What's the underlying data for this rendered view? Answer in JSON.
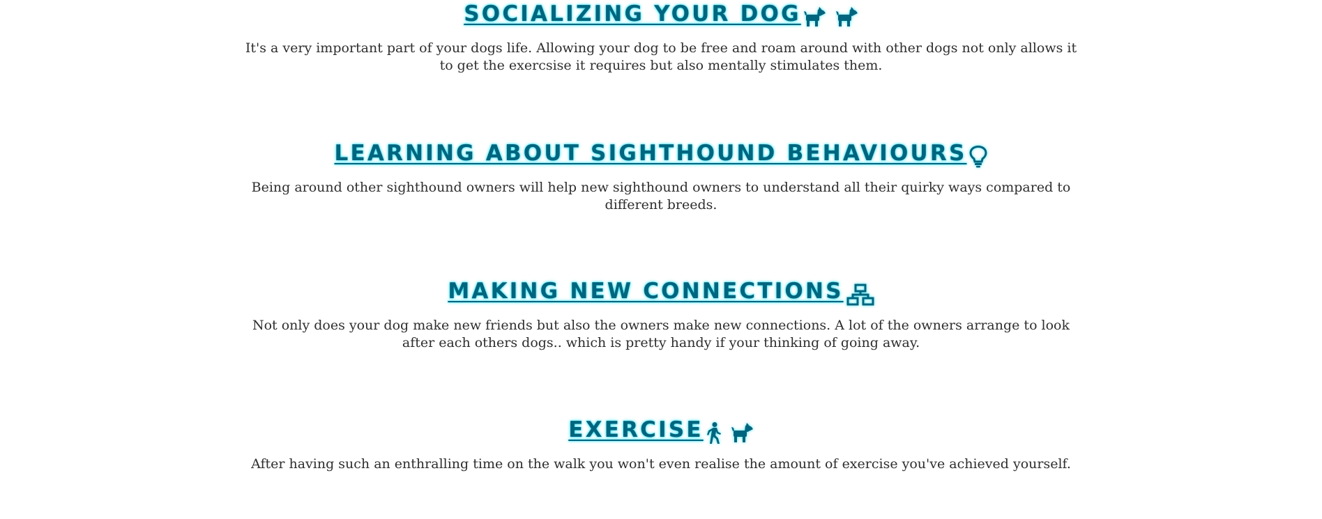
{
  "sections": [
    {
      "title": "SOCIALIZING YOUR DOG",
      "icons": [
        "dog-icon",
        "dog-icon"
      ],
      "body": "It's a very important part of your dogs life. Allowing your dog to be free and roam around with other dogs not only allows it to get the exercsise it requires but also mentally stimulates them."
    },
    {
      "title": "LEARNING ABOUT SIGHTHOUND BEHAVIOURS",
      "icons": [
        "lightbulb-icon"
      ],
      "body": "Being around other sighthound owners will help new sighthound owners to understand all their quirky ways compared to different breeds."
    },
    {
      "title": "MAKING NEW CONNECTIONS",
      "icons": [
        "network-icon"
      ],
      "body": "Not only does your dog make new friends but also the owners make new connections. A lot of the owners arrange to look after each others dogs.. which is pretty handy if your thinking of going away."
    },
    {
      "title": "EXERCISE",
      "icons": [
        "walking-person-icon",
        "dog-icon"
      ],
      "body": "After having such an enthralling time on the walk you won't even realise the amount of exercise you've achieved yourself."
    }
  ],
  "colors": {
    "heading": "#00657e",
    "heading_glow": "#3fe3f5",
    "body_text": "#2e2e2e",
    "background": "#ffffff"
  }
}
